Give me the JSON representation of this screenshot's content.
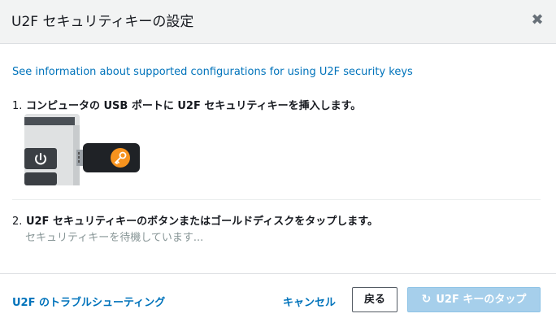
{
  "dialog": {
    "title": "U2F セキュリティキーの設定",
    "close_glyph": "✖"
  },
  "info_link": "See information about supported configurations for using U2F security keys",
  "steps": [
    {
      "number": "1.",
      "text": "コンピュータの USB ポートに U2F セキュリティキーを挿入します。"
    },
    {
      "number": "2.",
      "text": "U2F セキュリティキーのボタンまたはゴールドディスクをタップします。",
      "status": "セキュリティキーを待機しています..."
    }
  ],
  "footer": {
    "troubleshoot_label": "U2F のトラブルシューティング",
    "cancel_label": "キャンセル",
    "back_label": "戻る",
    "primary_label": "U2F キーのタップ",
    "primary_state": "disabled-loading"
  },
  "icons": {
    "close": "close-icon",
    "power": "power-icon",
    "key": "key-icon",
    "spinner": "spinner-icon"
  },
  "colors": {
    "link": "#0073bb",
    "primary_disabled": "#a6cfeb",
    "key_badge": "#f7931e"
  }
}
